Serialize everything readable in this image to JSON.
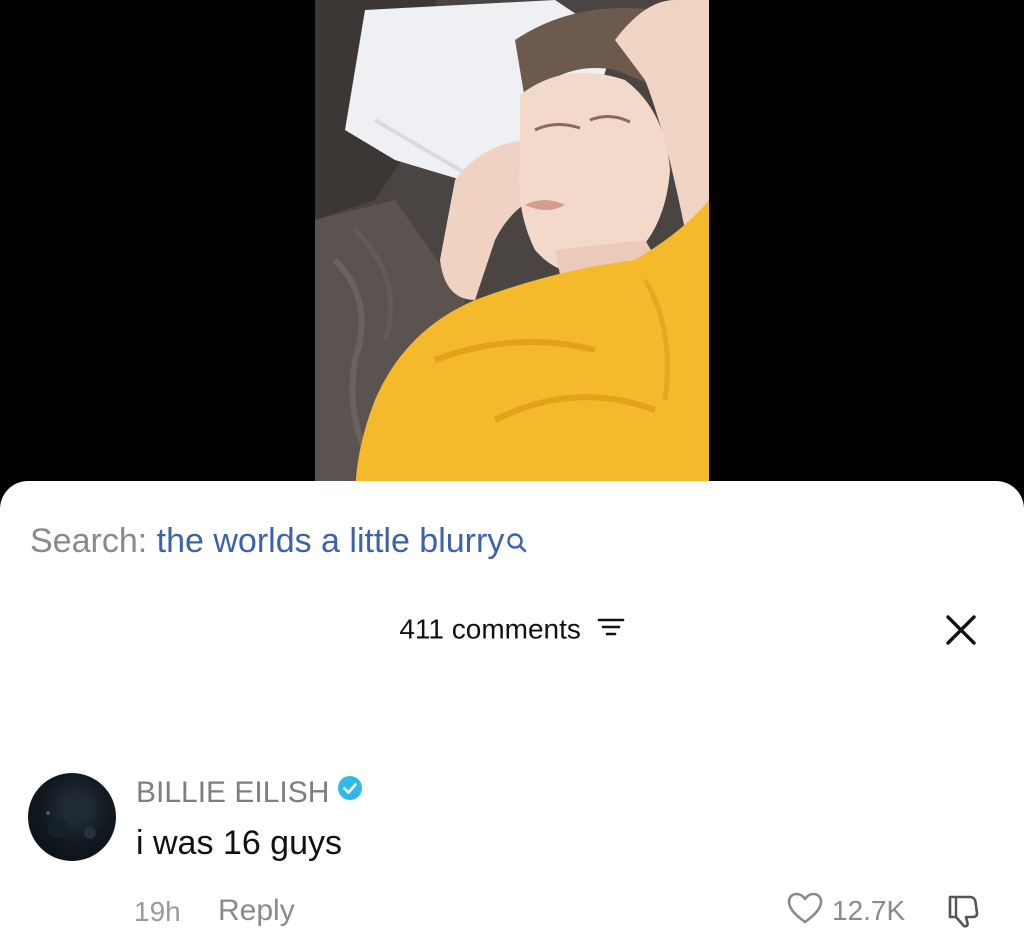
{
  "search": {
    "prefix": "Search:",
    "term": "the worlds a little blurry",
    "icon": "search-icon"
  },
  "comments_header": {
    "count_label": "411 comments",
    "filter_icon": "filter-icon",
    "close_icon": "close-icon"
  },
  "comment": {
    "username": "BILLIE EILISH",
    "verified": true,
    "text": "i was 16 guys",
    "time": "19h",
    "reply_label": "Reply",
    "like_count": "12.7K",
    "like_icon": "heart-icon",
    "dislike_icon": "dislike-icon"
  },
  "colors": {
    "search_term": "#3d62a8",
    "verified_badge": "#2fb8e8",
    "sheet_background": "#ffffff"
  }
}
